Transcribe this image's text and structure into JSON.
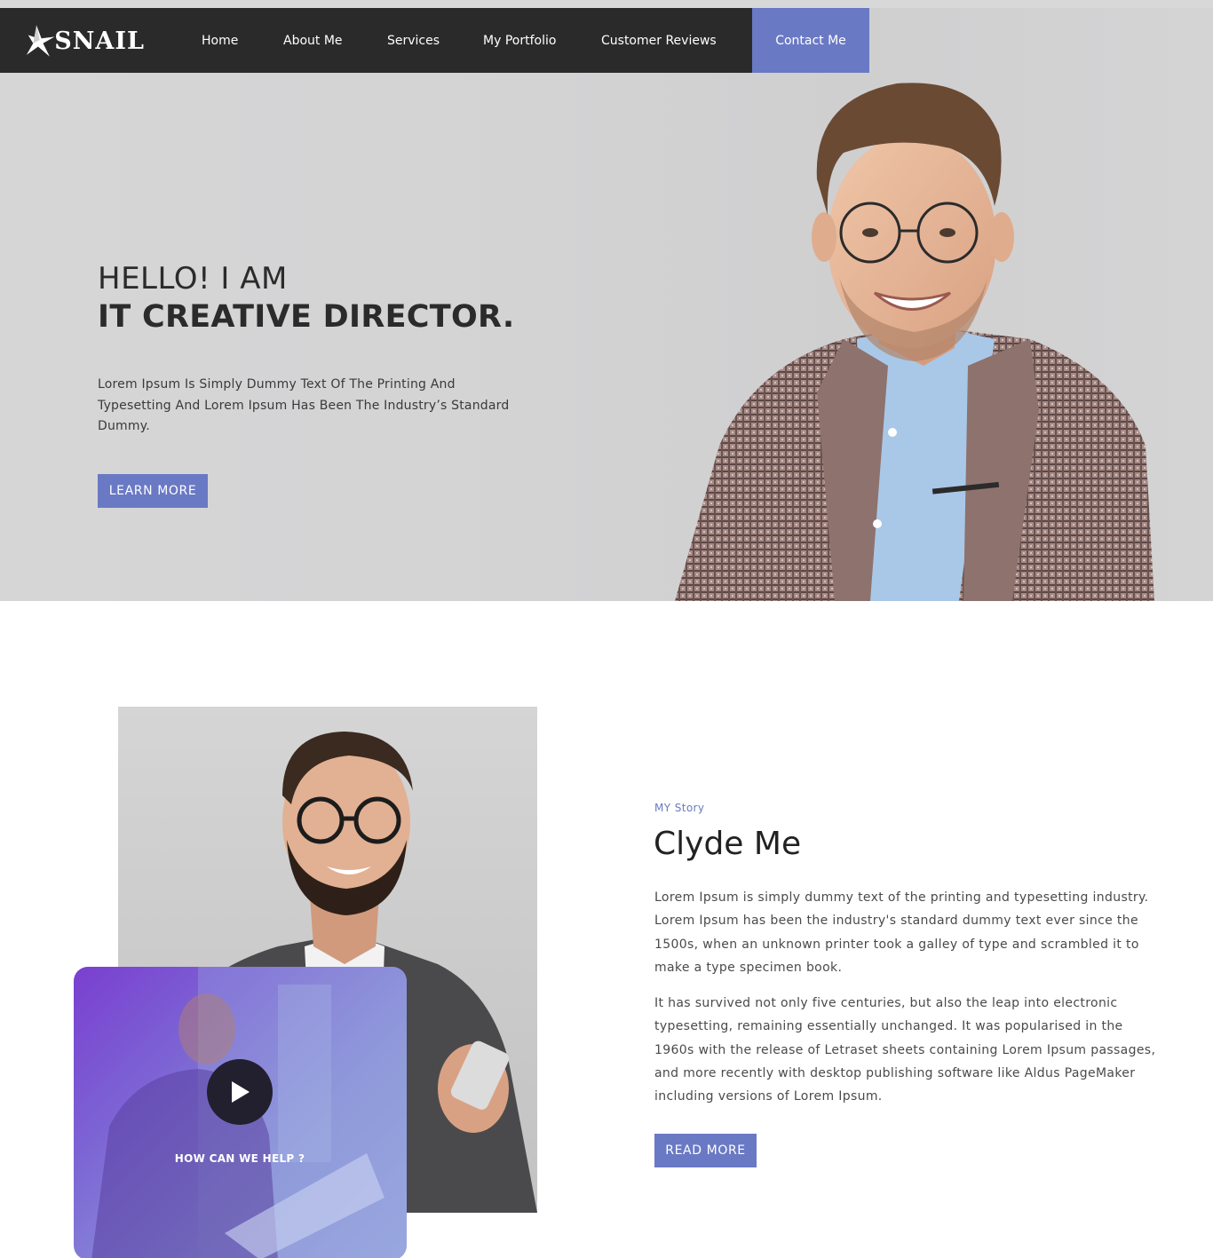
{
  "brand": {
    "name": "SNAIL",
    "accent": "#6a79c4",
    "nav_bg": "#2a2a2b"
  },
  "nav": {
    "items": [
      {
        "label": "Home"
      },
      {
        "label": "About Me"
      },
      {
        "label": "Services"
      },
      {
        "label": "My Portfolio"
      },
      {
        "label": "Customer Reviews"
      }
    ],
    "contact_label": "Contact Me"
  },
  "hero": {
    "line1": "HELLO! I AM",
    "line2": "IT CREATIVE DIRECTOR.",
    "description": "Lorem Ipsum Is Simply Dummy Text Of The Printing And Typesetting And Lorem Ipsum Has Been The Industry’s Standard Dummy.",
    "button_label": "LEARN MORE"
  },
  "video": {
    "caption": "HOW CAN WE HELP ?",
    "icon": "play-icon"
  },
  "story": {
    "kicker": "MY Story",
    "name": "Clyde Me",
    "paragraph1": "Lorem Ipsum is simply dummy text of the printing and typesetting industry. Lorem Ipsum has been the industry's standard dummy text ever since the 1500s, when an unknown printer took a galley of type and scrambled it to make a type specimen book.",
    "paragraph2": "It has survived not only five centuries, but also the leap into electronic typesetting, remaining essentially unchanged. It was popularised in the 1960s with the release of Letraset sheets containing Lorem Ipsum passages, and more recently with desktop publishing software like Aldus PageMaker including versions of Lorem Ipsum.",
    "button_label": "READ MORE"
  }
}
